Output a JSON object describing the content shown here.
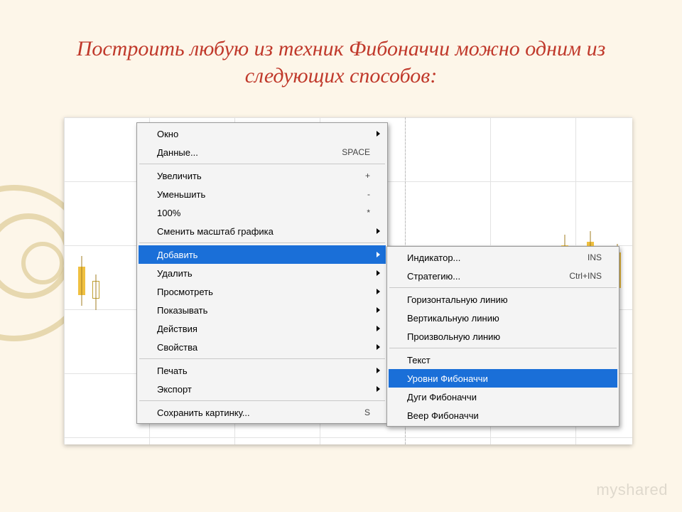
{
  "slide": {
    "title": "Построить любую из техник Фибоначчи можно одним из следующих способов:"
  },
  "watermark": "myshared",
  "main_menu": {
    "groups": [
      [
        {
          "label": "Окно",
          "submenu": true
        },
        {
          "label": "Данные...",
          "shortcut": "SPACE"
        }
      ],
      [
        {
          "label": "Увеличить",
          "shortcut": "+"
        },
        {
          "label": "Уменьшить",
          "shortcut": "-"
        },
        {
          "label": "100%",
          "shortcut": "*"
        },
        {
          "label": "Сменить масштаб графика",
          "submenu": true
        }
      ],
      [
        {
          "label": "Добавить",
          "submenu": true,
          "highlight": true
        },
        {
          "label": "Удалить",
          "submenu": true
        },
        {
          "label": "Просмотреть",
          "submenu": true
        },
        {
          "label": "Показывать",
          "submenu": true
        },
        {
          "label": "Действия",
          "submenu": true
        },
        {
          "label": "Свойства",
          "submenu": true
        }
      ],
      [
        {
          "label": "Печать",
          "submenu": true
        },
        {
          "label": "Экспорт",
          "submenu": true
        }
      ],
      [
        {
          "label": "Сохранить картинку...",
          "shortcut": "S"
        }
      ]
    ]
  },
  "sub_menu": {
    "groups": [
      [
        {
          "label": "Индикатор...",
          "shortcut": "INS"
        },
        {
          "label": "Стратегию...",
          "shortcut": "Ctrl+INS"
        }
      ],
      [
        {
          "label": "Горизонтальную линию"
        },
        {
          "label": "Вертикальную линию"
        },
        {
          "label": "Произвольную линию"
        }
      ],
      [
        {
          "label": "Текст"
        },
        {
          "label": "Уровни Фибоначчи",
          "highlight": true
        },
        {
          "label": "Дуги Фибоначчи"
        },
        {
          "label": "Веер Фибоначчи"
        }
      ]
    ]
  }
}
